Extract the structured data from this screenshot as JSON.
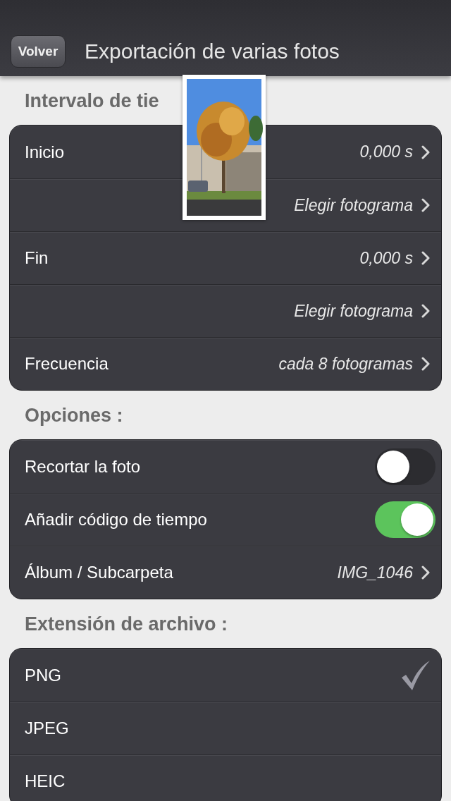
{
  "header": {
    "back_button": "Volver",
    "title": "Exportación de varias fotos"
  },
  "sections": [
    {
      "title": "Intervalo de tie",
      "rows": [
        {
          "kind": "nav",
          "label": "Inicio",
          "value": "0,000 s"
        },
        {
          "kind": "nav",
          "value": "Elegir fotograma"
        },
        {
          "kind": "nav",
          "label": "Fin",
          "value": "0,000 s"
        },
        {
          "kind": "nav",
          "value": "Elegir fotograma"
        },
        {
          "kind": "nav",
          "label": "Frecuencia",
          "value": "cada 8 fotogramas"
        }
      ]
    },
    {
      "title": "Opciones :",
      "rows": [
        {
          "kind": "toggle",
          "label": "Recortar la foto",
          "on": false
        },
        {
          "kind": "toggle",
          "label": "Añadir código de tiempo",
          "on": true
        },
        {
          "kind": "nav",
          "label": "Álbum / Subcarpeta",
          "value": "IMG_1046"
        }
      ]
    },
    {
      "title": "Extensión de archivo :",
      "rows": [
        {
          "kind": "choice",
          "label": "PNG",
          "selected": true
        },
        {
          "kind": "choice",
          "label": "JPEG",
          "selected": false
        },
        {
          "kind": "choice",
          "label": "HEIC",
          "selected": false
        }
      ]
    }
  ]
}
